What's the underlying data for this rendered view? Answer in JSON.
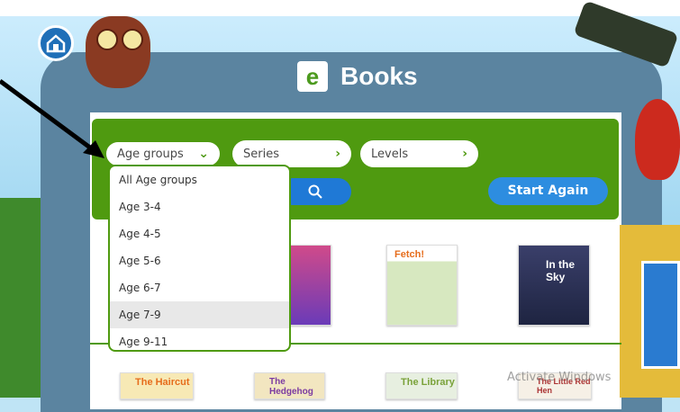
{
  "header": {
    "title": "Books",
    "logo_letter": "e"
  },
  "filters": {
    "age_groups_label": "Age groups",
    "series_label": "Series",
    "levels_label": "Levels",
    "start_again_label": "Start Again"
  },
  "age_menu": {
    "items": [
      "All Age groups",
      "Age 3-4",
      "Age 4-5",
      "Age 5-6",
      "Age 6-7",
      "Age 7-9",
      "Age 9-11"
    ],
    "highlighted": "Age 7-9"
  },
  "books": {
    "fetch": "Fetch!",
    "sky": "In the Sky",
    "haircut": "The Haircut",
    "hedgehog": "The Hedgehog",
    "library": "The Library",
    "redhen": "The Little Red Hen"
  },
  "watermark": "Activate Windows",
  "colors": {
    "brand_green": "#4f9a10",
    "button_blue": "#2d8de0",
    "panel": "#5b84a0"
  }
}
